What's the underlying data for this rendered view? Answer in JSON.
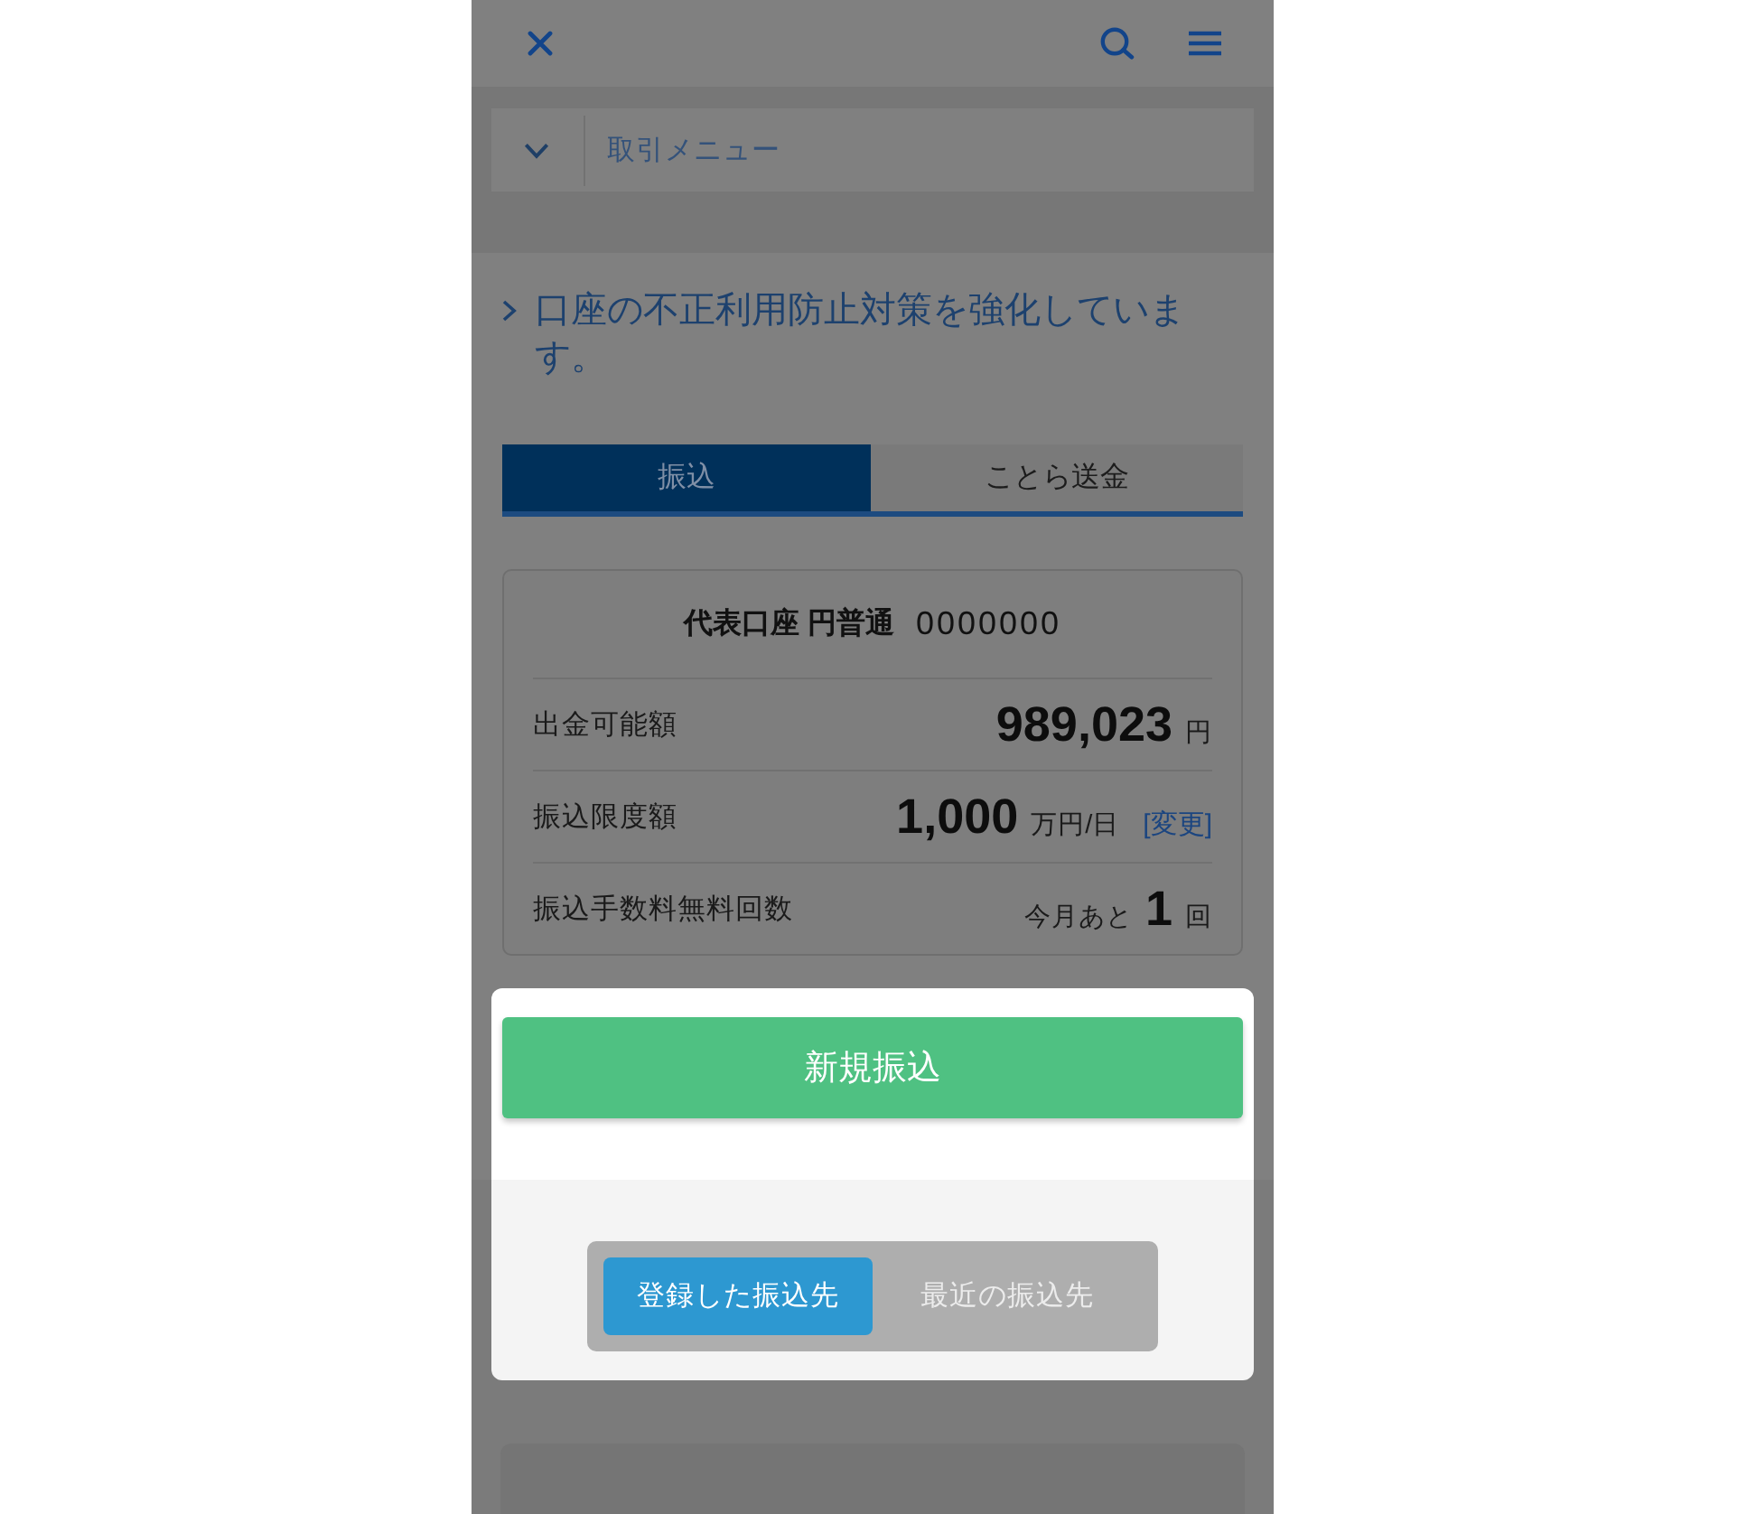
{
  "transaction_menu": {
    "label": "取引メニュー",
    "expanded": false
  },
  "notice": {
    "text": "口座の不正利用防止対策を強化しています。"
  },
  "tabs": [
    {
      "label": "振込",
      "selected": true
    },
    {
      "label": "ことら送金",
      "selected": false
    }
  ],
  "account": {
    "name": "代表口座 円普通",
    "number": "0000000",
    "rows": [
      {
        "label": "出金可能額",
        "parts": [
          {
            "kind": "figure",
            "text": "989,023"
          },
          {
            "kind": "unit",
            "text": "円"
          }
        ]
      },
      {
        "label": "振込限度額",
        "parts": [
          {
            "kind": "figure",
            "text": "1,000"
          },
          {
            "kind": "unit",
            "text": "万円/日"
          },
          {
            "kind": "link",
            "text": "[変更]"
          }
        ]
      },
      {
        "label": "振込手数料無料回数",
        "parts": [
          {
            "kind": "unit",
            "text": "今月あと"
          },
          {
            "kind": "figure",
            "text": "1"
          },
          {
            "kind": "unit",
            "text": "回"
          }
        ]
      }
    ]
  },
  "new_transfer_button": {
    "label": "新規振込"
  },
  "destination_switch": [
    {
      "label": "登録した振込先",
      "selected": true
    },
    {
      "label": "最近の振込先",
      "selected": false
    }
  ]
}
